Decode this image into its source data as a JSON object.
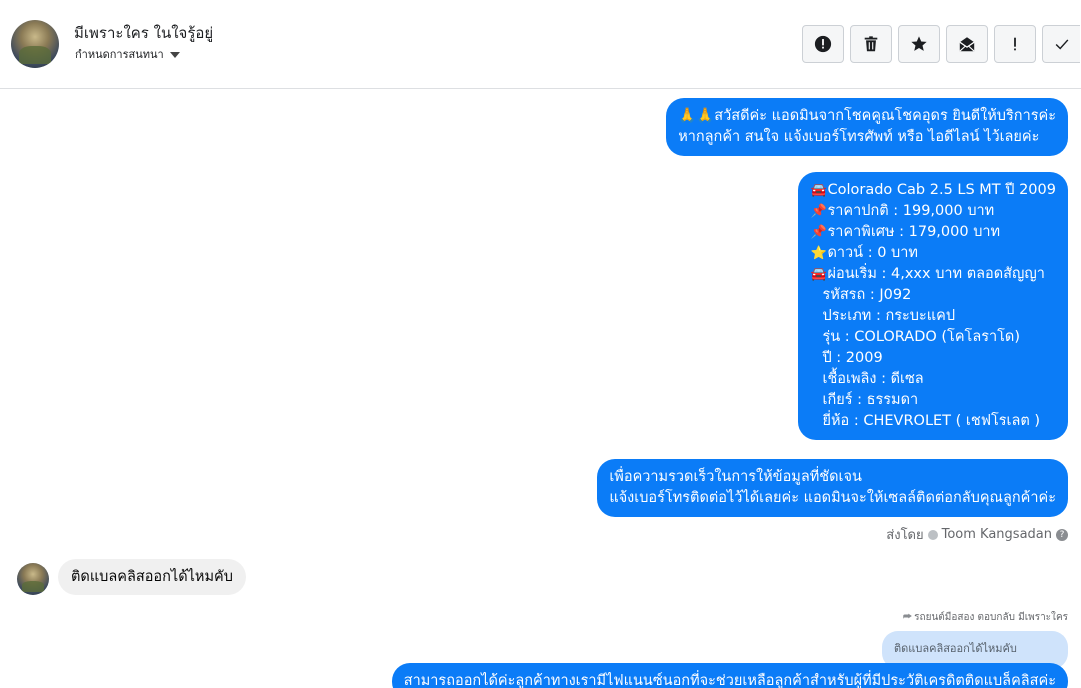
{
  "header": {
    "contact_name": "มีเพราะใคร ในใจรู้อยู่",
    "label_text": "กำหนดการสนทนา",
    "actions": [
      {
        "name": "report-icon",
        "label": "!"
      },
      {
        "name": "trash-icon",
        "label": ""
      },
      {
        "name": "star-icon",
        "label": ""
      },
      {
        "name": "mark-unread-icon",
        "label": ""
      },
      {
        "name": "important-icon",
        "label": "!"
      },
      {
        "name": "check-icon",
        "label": ""
      }
    ]
  },
  "messages": {
    "m1": {
      "line1": "🙏🙏สวัสดีค่ะ แอดมินจากโชคคูณโชคอุดร ยินดีให้บริการค่ะ",
      "line2": "หากลูกค้า สนใจ แจ้งเบอร์โทรศัพท์ หรือ ไอดีไลน์  ไว้เลยค่ะ"
    },
    "m2": {
      "lines": [
        {
          "emoji": "🚘",
          "text": "Colorado Cab 2.5 LS MT ปี 2009"
        },
        {
          "emoji": "📌",
          "text": "ราคาปกติ : 199,000 บาท"
        },
        {
          "emoji": "📌",
          "text": "ราคาพิเศษ : 179,000 บาท"
        },
        {
          "emoji": "⭐",
          "text": "ดาวน์ : 0 บาท"
        },
        {
          "emoji": "🚘",
          "text": "ผ่อนเริ่ม : 4,xxx บาท ตลอดสัญญา"
        },
        {
          "emoji": "",
          "text": "รหัสรถ : J092"
        },
        {
          "emoji": "",
          "text": "ประเภท : กระบะแคป"
        },
        {
          "emoji": "",
          "text": "รุ่น : COLORADO (โคโลราโด)"
        },
        {
          "emoji": "",
          "text": "ปี : 2009"
        },
        {
          "emoji": "",
          "text": "เชื้อเพลิง : ดีเซล"
        },
        {
          "emoji": "",
          "text": "เกียร์ : ธรรมดา"
        },
        {
          "emoji": "",
          "text": "ยี่ห้อ : CHEVROLET ( เชฟโรเลต )"
        }
      ]
    },
    "m3": {
      "line1": "เพื่อความรวดเร็วในการให้ข้อมูลที่ชัดเจน",
      "line2": "แจ้งเบอร์โทรติดต่อไว้ได้เลยค่ะ แอดมินจะให้เซลล์ติดต่อกลับคุณลูกค้าค่ะ"
    },
    "sent_by_prefix": "ส่งโดย",
    "sent_by_name": "Toom Kangsadan",
    "incoming": "ติดแบลคลิสออกได้ไหมคับ",
    "reply_note": "รถยนต์มือสอง ตอบกลับ มีเพราะใคร",
    "quoted_text": "ติดแบลคลิสออกได้ไหมคับ",
    "m4": "สามารถออกได้ค่ะลูกค้าทางเรามีไฟแนนซ์นอกที่จะช่วยเหลือลูกค้าสำหรับผู้ที่มีประวัติเครดิตติดแบล็คลิสค่ะ"
  },
  "colors": {
    "outgoing_bubble": "#0b7cf7",
    "incoming_bubble": "#f0f0f0",
    "quoted_bubble": "#cfe3fb"
  }
}
